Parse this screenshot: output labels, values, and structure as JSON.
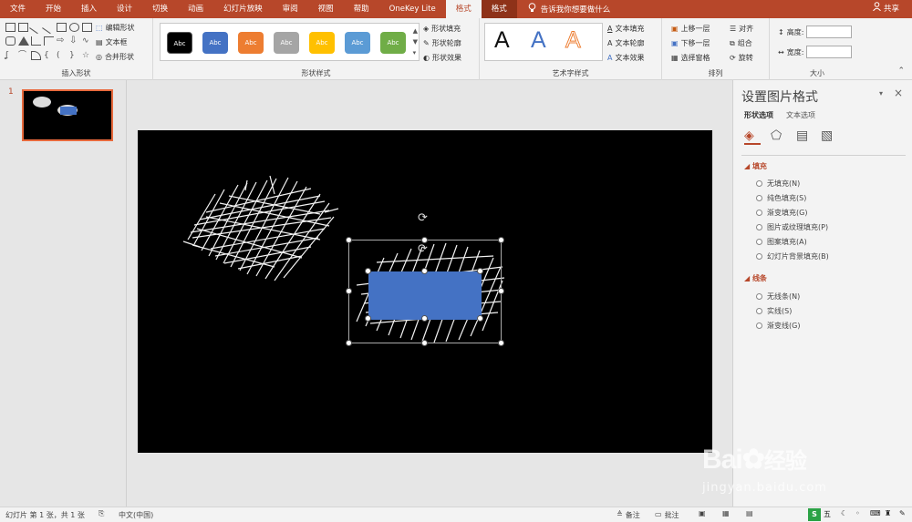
{
  "tabs": [
    {
      "label": "文件"
    },
    {
      "label": "开始"
    },
    {
      "label": "插入"
    },
    {
      "label": "设计"
    },
    {
      "label": "切换"
    },
    {
      "label": "动画"
    },
    {
      "label": "幻灯片放映"
    },
    {
      "label": "审阅"
    },
    {
      "label": "视图"
    },
    {
      "label": "帮助"
    },
    {
      "label": "OneKey Lite"
    },
    {
      "label": "格式"
    },
    {
      "label": "格式"
    }
  ],
  "tell_me": "告诉我你想要做什么",
  "share": "共享",
  "ribbon": {
    "insert_shapes": {
      "edit_shape": "编辑形状",
      "text_box": "文本框",
      "merge_shape": "合并形状",
      "label": "插入形状"
    },
    "shape_styles": {
      "swatch_text": "Abc",
      "fill": "形状填充",
      "outline": "形状轮廓",
      "effect": "形状效果",
      "label": "形状样式",
      "swatch_colors": [
        "#000000",
        "#4472c4",
        "#ed7d31",
        "#a5a5a5",
        "#ffc000",
        "#5b9bd5",
        "#70ad47"
      ]
    },
    "wordart": {
      "letter": "A",
      "text_fill": "文本填充",
      "text_outline": "文本轮廓",
      "text_effect": "文本效果",
      "label": "艺术字样式"
    },
    "arrange": {
      "bring_forward": "上移一层",
      "send_backward": "下移一层",
      "selection_pane": "选择窗格",
      "align": "对齐",
      "group": "组合",
      "rotate": "旋转",
      "label": "排列"
    },
    "size": {
      "height": "高度:",
      "width": "宽度:",
      "label": "大小"
    }
  },
  "slides_pane": {
    "slide_number": "1"
  },
  "format_pane": {
    "title": "设置图片格式",
    "tab_shape": "形状选项",
    "tab_text": "文本选项",
    "fill_section": "填充",
    "fill_options": [
      "无填充(N)",
      "纯色填充(S)",
      "渐变填充(G)",
      "图片或纹理填充(P)",
      "图案填充(A)",
      "幻灯片背景填充(B)"
    ],
    "line_section": "线条",
    "line_options": [
      "无线条(N)",
      "实线(S)",
      "渐变线(G)"
    ]
  },
  "status": {
    "slide_info": "幻灯片 第 1 张，共 1 张",
    "language": "中文(中国)",
    "notes": "备注",
    "comments": "批注"
  },
  "watermark": {
    "brand": "Bai",
    "brand2": "经验",
    "url": "jingyan.baidu.com"
  },
  "colors": {
    "accent": "#b7472a",
    "rect_fill": "#4472c4",
    "slide_bg": "#000000"
  }
}
